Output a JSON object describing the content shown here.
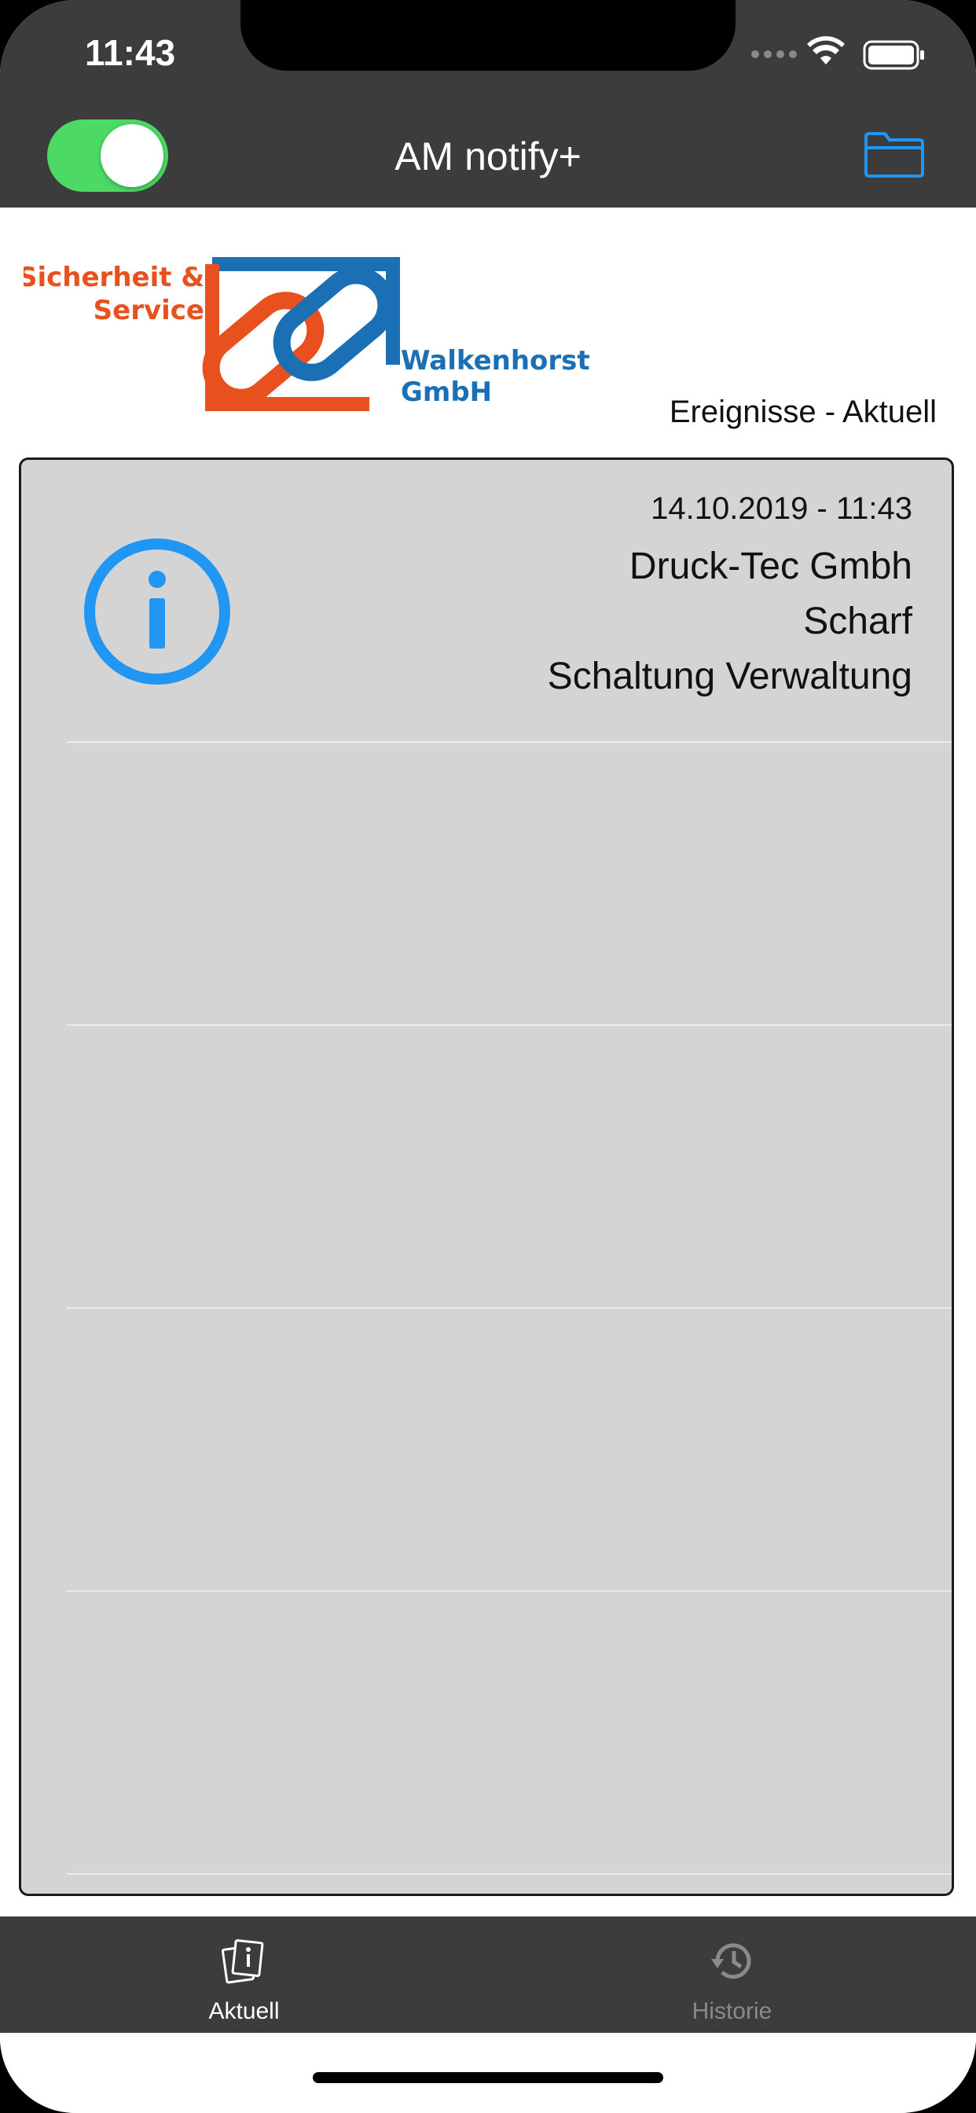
{
  "status_bar": {
    "time": "11:43"
  },
  "nav": {
    "title": "AM notify+",
    "toggle_on": true
  },
  "logo": {
    "line1": "Sicherheit &",
    "line2": "Service",
    "line3": "Walkenhorst",
    "line4": "GmbH"
  },
  "subtitle": "Ereignisse - Aktuell",
  "events": [
    {
      "date": "14.10.2019 - 11:43",
      "company": "Druck-Tec Gmbh",
      "state": "Scharf",
      "zone": "Schaltung Verwaltung",
      "icon": "info-icon"
    }
  ],
  "tabs": [
    {
      "label": "Aktuell",
      "icon": "notes-icon",
      "active": true
    },
    {
      "label": "Historie",
      "icon": "history-icon",
      "active": false
    }
  ],
  "colors": {
    "bar": "#3c3c3c",
    "accent": "#2196f3",
    "toggle": "#4cd964",
    "logo_orange": "#e8501e",
    "logo_blue": "#1a6fb5"
  }
}
